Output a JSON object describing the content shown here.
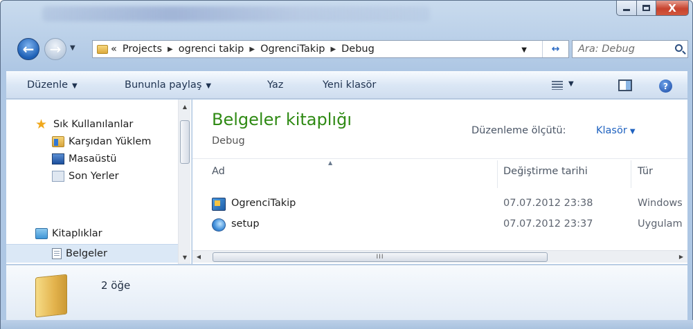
{
  "window": {
    "close_glyph": "X"
  },
  "address": {
    "overflow": "«",
    "crumbs": [
      "Projects",
      "ogrenci takip",
      "OgrenciTakip",
      "Debug"
    ],
    "search_placeholder": "Ara: Debug"
  },
  "toolbar": {
    "organize": "Düzenle",
    "share": "Bununla paylaş",
    "burn": "Yaz",
    "new_folder": "Yeni klasör"
  },
  "nav": {
    "favorites": "Sık Kullanılanlar",
    "downloads": "Karşıdan Yüklem",
    "desktop": "Masaüstü",
    "recent": "Son Yerler",
    "libraries": "Kitaplıklar",
    "documents": "Belgeler"
  },
  "content": {
    "title": "Belgeler kitaplığı",
    "subtitle": "Debug",
    "arrange_label": "Düzenleme ölçütü:",
    "arrange_value": "Klasör",
    "columns": {
      "name": "Ad",
      "date": "Değiştirme tarihi",
      "type": "Tür"
    },
    "files": [
      {
        "name": "OgrenciTakip",
        "date": "07.07.2012 23:38",
        "type": "Windows",
        "icon": "application-icon"
      },
      {
        "name": "setup",
        "date": "07.07.2012 23:37",
        "type": "Uygulam",
        "icon": "setup-icon"
      }
    ],
    "scroll_thumb": "III"
  },
  "details": {
    "count": "2 öğe"
  }
}
